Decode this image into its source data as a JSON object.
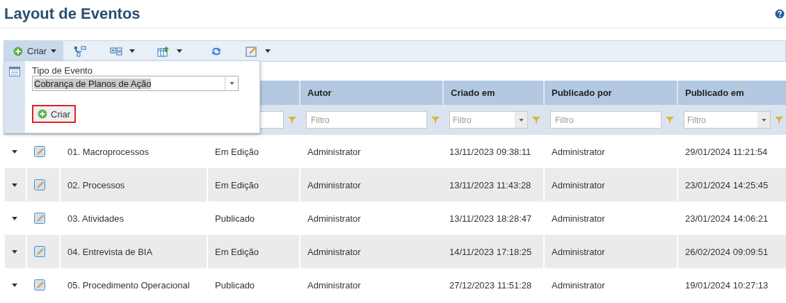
{
  "title": "Layout de Eventos",
  "toolbar": {
    "create_label": "Criar",
    "create_open": true
  },
  "create_popup": {
    "field_label": "Tipo de Evento",
    "value": "Cobrança de Planos de Ação",
    "button": "Criar"
  },
  "filters_hidden_columns": [
    {
      "kind": "text"
    }
  ],
  "columns": [
    {
      "label": "Autor",
      "kind": "text",
      "placeholder": "Filtro"
    },
    {
      "label": "Criado em",
      "kind": "select",
      "placeholder": "Filtro"
    },
    {
      "label": "Publicado por",
      "kind": "text",
      "placeholder": "Filtro"
    },
    {
      "label": "Publicado em",
      "kind": "select",
      "placeholder": "Filtro"
    }
  ],
  "rows": [
    {
      "name": "01. Macroprocessos",
      "status": "Em Edição",
      "author": "Administrator",
      "created": "13/11/2023 09:38:11",
      "published_by": "Administrator",
      "published_at": "29/01/2024 11:21:54"
    },
    {
      "name": "02. Processos",
      "status": "Em Edição",
      "author": "Administrator",
      "created": "13/11/2023 11:43:28",
      "published_by": "Administrator",
      "published_at": "23/01/2024 14:25:45"
    },
    {
      "name": "03. Atividades",
      "status": "Publicado",
      "author": "Administrator",
      "created": "13/11/2023 18:28:47",
      "published_by": "Administrator",
      "published_at": "23/01/2024 14:06:21"
    },
    {
      "name": "04. Entrevista de BIA",
      "status": "Em Edição",
      "author": "Administrator",
      "created": "14/11/2023 17:18:25",
      "published_by": "Administrator",
      "published_at": "26/02/2024 09:09:51"
    },
    {
      "name": "05. Procedimento Operacional",
      "status": "Publicado",
      "author": "Administrator",
      "created": "27/12/2023 11:51:28",
      "published_by": "Administrator",
      "published_at": "19/01/2024 10:27:13"
    }
  ]
}
